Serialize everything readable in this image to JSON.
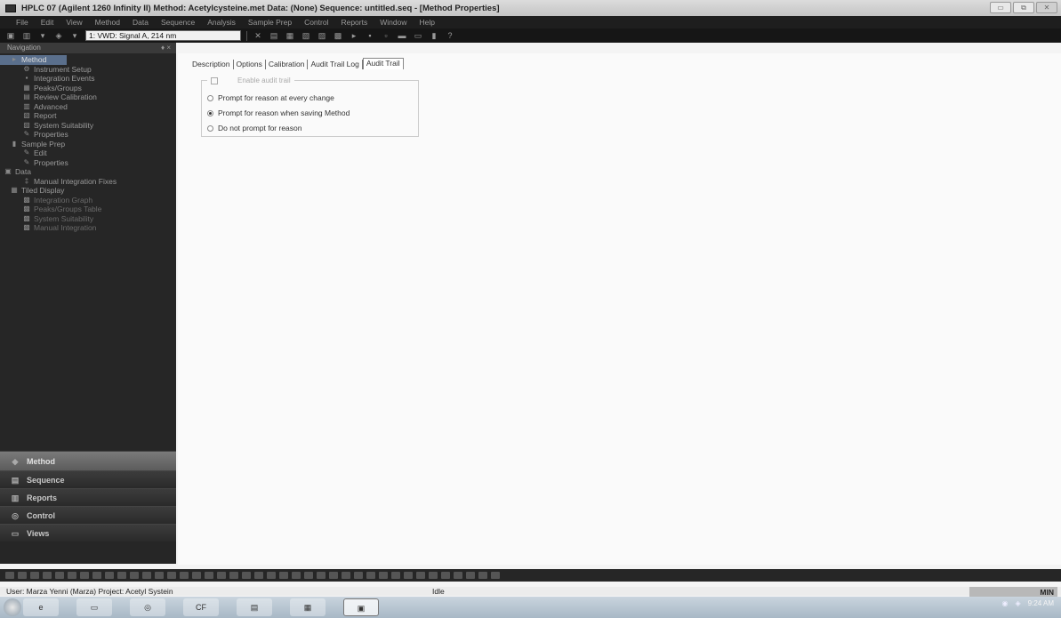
{
  "window": {
    "title": "HPLC 07 (Agilent 1260 Infinity II)    Method: Acetylcysteine.met    Data: (None)    Sequence: untitled.seq - [Method Properties]",
    "controls": [
      "▭",
      "⧉",
      "✕"
    ]
  },
  "menu": [
    "File",
    "Edit",
    "View",
    "Method",
    "Data",
    "Sequence",
    "Analysis",
    "Sample Prep",
    "Control",
    "Reports",
    "Window",
    "Help"
  ],
  "toolbar": {
    "signal_value": "1: VWD: Signal A, 214 nm",
    "icons": [
      "▣",
      "▥",
      "▾",
      "◈",
      "▾",
      "✕",
      "▤",
      "▦",
      "▧",
      "▨",
      "▩",
      "▸",
      "▪",
      "▫",
      "▬",
      "▭",
      "▮",
      "?"
    ]
  },
  "nav": {
    "header": "Navigation",
    "pin": "♦ ×",
    "tree": [
      {
        "label": "Method",
        "icon": "▸",
        "indent": 1,
        "selected": true,
        "dim": false
      },
      {
        "label": "Instrument Setup",
        "icon": "⚙",
        "indent": 3,
        "selected": false,
        "dim": false
      },
      {
        "label": "Integration Events",
        "icon": "▪",
        "indent": 3,
        "selected": false,
        "dim": false
      },
      {
        "label": "Peaks/Groups",
        "icon": "▦",
        "indent": 3,
        "selected": false,
        "dim": false
      },
      {
        "label": "Review Calibration",
        "icon": "▤",
        "indent": 3,
        "selected": false,
        "dim": false
      },
      {
        "label": "Advanced",
        "icon": "▥",
        "indent": 3,
        "selected": false,
        "dim": false
      },
      {
        "label": "Report",
        "icon": "▧",
        "indent": 3,
        "selected": false,
        "dim": false
      },
      {
        "label": "System Suitability",
        "icon": "▨",
        "indent": 3,
        "selected": false,
        "dim": false
      },
      {
        "label": "Properties",
        "icon": "✎",
        "indent": 3,
        "selected": false,
        "dim": false
      },
      {
        "label": "Sample Prep",
        "icon": "▮",
        "indent": 1,
        "selected": false,
        "dim": false
      },
      {
        "label": "Edit",
        "icon": "✎",
        "indent": 3,
        "selected": false,
        "dim": false
      },
      {
        "label": "Properties",
        "icon": "✎",
        "indent": 3,
        "selected": false,
        "dim": false
      },
      {
        "label": "Data",
        "icon": "▣",
        "indent": 0,
        "selected": false,
        "dim": false
      },
      {
        "label": "Manual Integration Fixes",
        "icon": "‡",
        "indent": 3,
        "selected": false,
        "dim": false
      },
      {
        "label": "Tiled Display",
        "icon": "▦",
        "indent": 1,
        "selected": false,
        "dim": false
      },
      {
        "label": "Integration Graph",
        "icon": "▩",
        "indent": 3,
        "selected": false,
        "dim": true
      },
      {
        "label": "Peaks/Groups Table",
        "icon": "▩",
        "indent": 3,
        "selected": false,
        "dim": true
      },
      {
        "label": "System Suitability",
        "icon": "▩",
        "indent": 3,
        "selected": false,
        "dim": true
      },
      {
        "label": "Manual Integration",
        "icon": "▩",
        "indent": 3,
        "selected": false,
        "dim": true
      }
    ],
    "buttons": [
      {
        "label": "Method",
        "icon": "◆",
        "active": true
      },
      {
        "label": "Sequence",
        "icon": "▤",
        "active": false
      },
      {
        "label": "Reports",
        "icon": "▥",
        "active": false
      },
      {
        "label": "Control",
        "icon": "◎",
        "active": false
      },
      {
        "label": "Views",
        "icon": "▭",
        "active": false
      }
    ]
  },
  "main": {
    "tabs": [
      "Description",
      "Options",
      "Calibration",
      "Audit Trail Log",
      "Audit Trail"
    ],
    "active_tab": 4,
    "group_checkbox_label": "Enable audit trail",
    "radios": [
      {
        "label": "Prompt for reason at every change",
        "checked": false
      },
      {
        "label": "Prompt for reason when saving Method",
        "checked": true
      },
      {
        "label": "Do not prompt for reason",
        "checked": false
      }
    ]
  },
  "status": {
    "user": "User: Marza Yenni (Marza)  Project: Acetyl Systein",
    "state": "Idle",
    "mode": "MIN"
  },
  "taskbar": {
    "apps": [
      "e",
      "▭",
      "◎",
      "CF",
      "▤",
      "▦",
      "▣"
    ],
    "clock": "9:24 AM"
  }
}
